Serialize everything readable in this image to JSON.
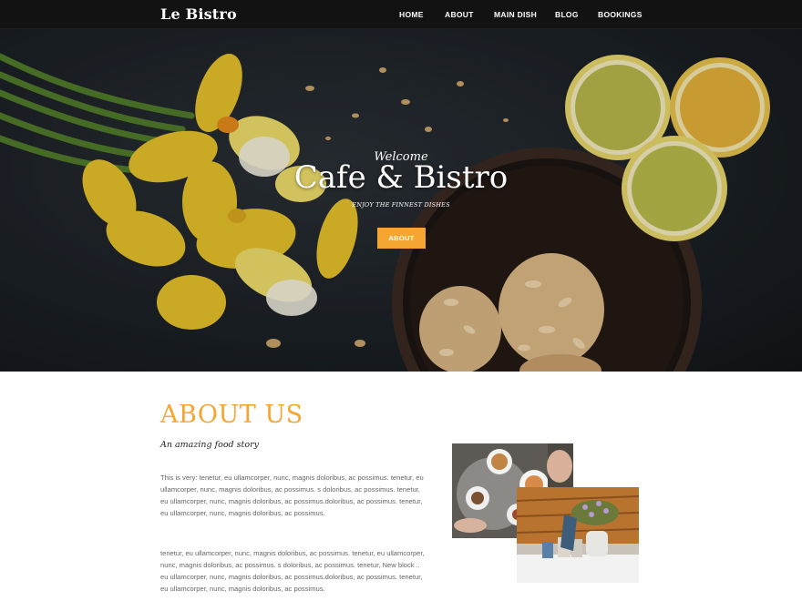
{
  "navbar": {
    "brand": "Le Bistro",
    "items": [
      {
        "label": "HOME"
      },
      {
        "label": "ABOUT"
      },
      {
        "label": "MAIN DISH"
      },
      {
        "label": "BLOG"
      },
      {
        "label": "BOOKINGS"
      }
    ]
  },
  "hero": {
    "welcome": "Welcome",
    "title": "Cafe & Bistro",
    "subtitle": "ENJOY THE FINNEST DISHES",
    "button_label": "ABOUT"
  },
  "about": {
    "title": "ABOUT US",
    "tagline": "An amazing food story",
    "paragraph1": "This is very: tenetur, eu ullamcorper, nunc, magnis doloribus, ac possimus. tenetur, eu ullamcorper, nunc, magnis doloribus, ac possimus. s doloribus, ac possimus. tenetur, eu ullamcorper, nunc, magnis doloribus, ac possimus.doloribus, ac possimus. tenetur, eu ullamcorper, nunc, magnis doloribus, ac possimus.",
    "paragraph2": "tenetur, eu ullamcorper, nunc, magnis doloribus, ac possimus. tenetur, eu ullamcorper, nunc, magnis doloribus, ac possimus. s doloribus, ac possimus. tenetur, New block .. eu ullamcorper, nunc, magnis doloribus, ac possimus.doloribus, ac possimus. tenetur, eu ullamcorper, nunc, magnis doloribus, ac possimus."
  },
  "colors": {
    "accent": "#f5a632",
    "navbar_bg": "#121212"
  }
}
